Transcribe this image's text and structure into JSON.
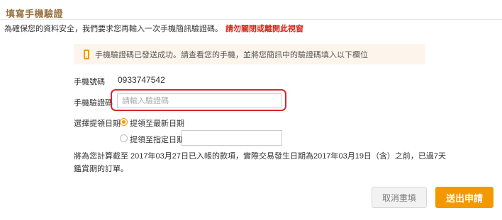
{
  "page": {
    "title": "填寫手機驗證",
    "intro_text": "為確保您的資料安全，我們要求您再輸入一次手機簡訊驗證碼。",
    "intro_warning": "請勿關閉或離開此視窗"
  },
  "notice": {
    "icon": "mobile-phone-icon",
    "text": "手機驗證碼已發送成功。請查看您的手機，並將您簡訊中的驗證碼填入以下欄位"
  },
  "form": {
    "phone_label": "手機號碼",
    "phone_value": "0933747542",
    "code_label": "手機驗證碼",
    "code_placeholder": "請輸入驗證碼",
    "code_value": "",
    "date_label": "選擇提領日期",
    "option_latest": "提領至最新日期",
    "option_specified": "提領至指定日期",
    "selected_option": "latest",
    "specified_date_value": ""
  },
  "info_text": "將為您計算截至 2017年03月27日已入帳的款項，實際交易發生日期為2017年03月19日（含）之前，已過7天鑑賞期的訂單。",
  "buttons": {
    "cancel_label": "取消重填",
    "submit_label": "送出申請"
  },
  "colors": {
    "accent": "#f39800",
    "warning": "#d4281c",
    "title": "#9a7444",
    "highlight_frame": "#d9262c"
  }
}
